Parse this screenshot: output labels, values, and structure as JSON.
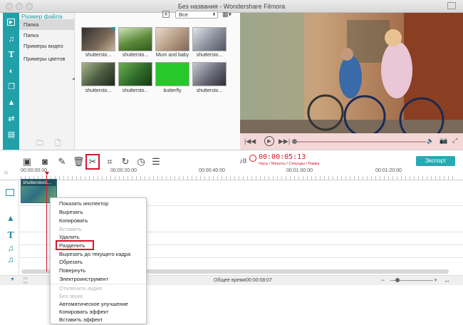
{
  "window": {
    "title": "Без названия - Wondershare Filmora"
  },
  "left_nav": {
    "icons": [
      "media-icon",
      "music-icon",
      "text-icon",
      "filter-icon",
      "overlay-icon",
      "elements-icon",
      "transitions-icon",
      "split-screen-icon"
    ]
  },
  "categories": {
    "header": "Размер файла",
    "items": [
      {
        "label": "Папка",
        "selected": true
      },
      {
        "label": "Папка",
        "selected": false
      },
      {
        "label": "Примеры видео",
        "selected": false
      },
      {
        "label": "Примеры цветов",
        "selected": false
      }
    ]
  },
  "media_toolbar": {
    "filter_value": "Все"
  },
  "media_items": [
    {
      "caption": "shutterstо...",
      "tone": "#7b6a5a"
    },
    {
      "caption": "shutterstо...",
      "tone": "#5d8a3a"
    },
    {
      "caption": "Mum and baby",
      "tone": "#b49a82"
    },
    {
      "caption": "shutterstо...",
      "tone": "#8a8f9a"
    },
    {
      "caption": "shutterstо...",
      "tone": "#4a5a40"
    },
    {
      "caption": "shutterstо...",
      "tone": "#2f6a2a"
    },
    {
      "caption": "butterfly",
      "tone": "#27c829"
    },
    {
      "caption": "shutterstо...",
      "tone": "#6a6a78"
    }
  ],
  "playback": {
    "progress": 0.0
  },
  "editor_toolbar": {
    "timecode": "00:00:05:13",
    "timecode_caption": "Часы / Минуты / Секунды / Рамка",
    "export_label": "Экспорт"
  },
  "ruler": {
    "labels": [
      "00:00:00:00",
      "00:00:20:00",
      "00:00:40:00",
      "00:01:00:00",
      "00:01:20:00"
    ]
  },
  "clip": {
    "label": "shutterstock..."
  },
  "status": {
    "total_time": "Общее время00:00:08:07"
  },
  "context_menu": {
    "items": [
      {
        "label": "Показать инспектор",
        "disabled": false,
        "highlighted": false
      },
      {
        "label": "Вырезать",
        "disabled": false,
        "highlighted": false
      },
      {
        "label": "Копировать",
        "disabled": false,
        "highlighted": false
      },
      {
        "label": "Вставить",
        "disabled": true,
        "highlighted": false
      },
      {
        "label": "Удалить",
        "disabled": false,
        "highlighted": false
      },
      {
        "label": "Разделить",
        "disabled": false,
        "highlighted": true
      },
      {
        "label": "Вырезать до текущего кадра",
        "disabled": false,
        "highlighted": false
      },
      {
        "label": "Обрезать",
        "disabled": false,
        "highlighted": false
      },
      {
        "label": "Повернуть",
        "disabled": false,
        "highlighted": false
      },
      {
        "label": "Электроинструмент",
        "disabled": false,
        "highlighted": false
      },
      {
        "label": "Отключить аудио",
        "disabled": true,
        "highlighted": false
      },
      {
        "label": "Без звука",
        "disabled": true,
        "highlighted": false
      },
      {
        "label": "Автоматическое улучшение",
        "disabled": false,
        "highlighted": false
      },
      {
        "label": "Копировать эффект",
        "disabled": false,
        "highlighted": false
      },
      {
        "label": "Вставить эффект",
        "disabled": false,
        "highlighted": false
      }
    ]
  },
  "colors": {
    "accent": "#21a0a8",
    "highlight_box": "#d5172c",
    "timecode": "#d5172c",
    "export_button": "#2aa8b3"
  }
}
